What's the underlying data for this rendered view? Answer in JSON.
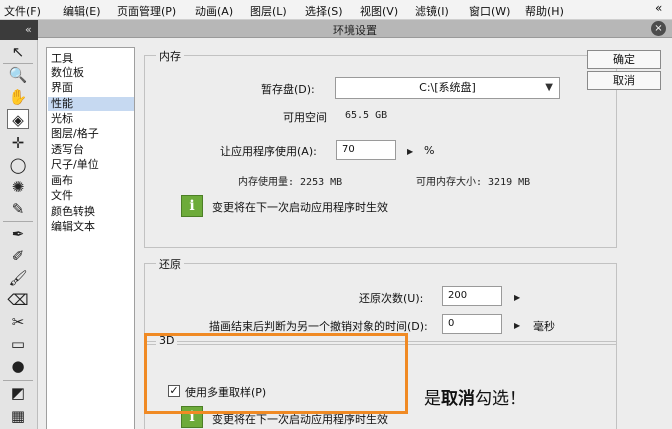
{
  "menubar": {
    "items": [
      "文件(F)",
      "编辑(E)",
      "页面管理(P)",
      "动画(A)",
      "图层(L)",
      "选择(S)",
      "视图(V)",
      "滤镜(I)",
      "窗口(W)",
      "帮助(H)"
    ],
    "collapse_label": "«"
  },
  "toolbar": {
    "collapse_label": "«",
    "tools": [
      "↖",
      "🔍",
      "✋",
      "◈",
      "✛",
      "◯",
      "✺",
      "✎",
      "✒",
      "✐",
      "🖌",
      "⌫",
      "✂",
      "▭",
      "●",
      "◩",
      "▦"
    ]
  },
  "dialog": {
    "title": "环境设置",
    "close_label": "×",
    "categories": [
      "工具",
      "数位板",
      "界面",
      "性能",
      "光标",
      "图层/格子",
      "透写台",
      "尺子/单位",
      "画布",
      "文件",
      "颜色转换",
      "编辑文本"
    ],
    "selected_category": "性能",
    "ok_label": "确定",
    "cancel_label": "取消",
    "memory": {
      "title": "内存",
      "scratch_label": "暂存盘(D):",
      "scratch_value": "C:\\[系统盘]",
      "free_space_label": "可用空间",
      "free_space_value": "65.5 GB",
      "app_use_label": "让应用程序使用(A):",
      "app_use_value": "70",
      "app_use_unit": "%",
      "usage_label": "内存使用量: 2253 MB",
      "available_label": "可用内存大小: 3219 MB",
      "notice": "变更将在下一次启动应用程序时生效"
    },
    "undo": {
      "title": "还原",
      "count_label": "还原次数(U):",
      "count_value": "200",
      "delay_label": "描画结束后判断为另一个撤销对象的时间(D):",
      "delay_value": "0",
      "delay_unit": "毫秒"
    },
    "threed": {
      "title": "3D",
      "multisample_label": "使用多重取样(P)",
      "multisample_checked": true,
      "notice": "变更将在下一次启动应用程序时生效"
    }
  },
  "annotation": {
    "prefix": "是",
    "bold": "取消",
    "suffix": "勾选！",
    "highlight_color": "#f08a24"
  }
}
